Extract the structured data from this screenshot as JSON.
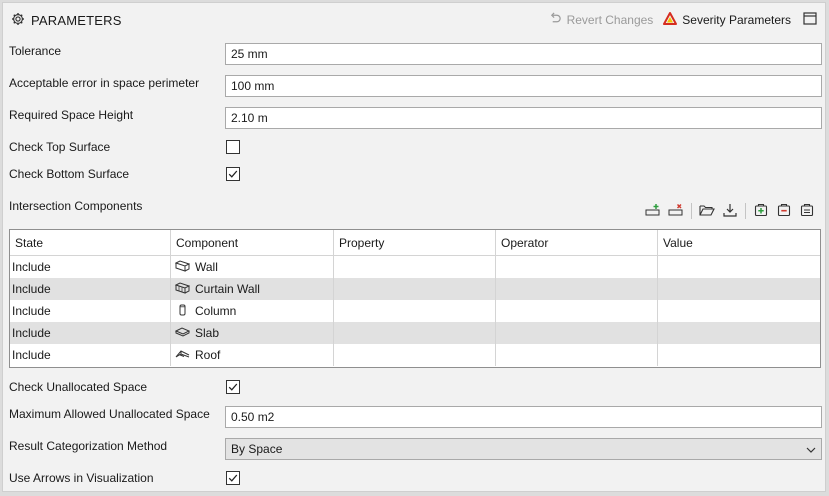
{
  "header": {
    "title": "PARAMETERS",
    "revert_label": "Revert Changes",
    "severity_label": "Severity Parameters"
  },
  "fields": {
    "tolerance": {
      "label": "Tolerance",
      "value": "25 mm"
    },
    "perimeter_error": {
      "label": "Acceptable error in space perimeter",
      "value": "100 mm"
    },
    "space_height": {
      "label": "Required Space Height",
      "value": "2.10 m"
    },
    "check_top": {
      "label": "Check Top Surface",
      "checked": false
    },
    "check_bottom": {
      "label": "Check Bottom Surface",
      "checked": true
    }
  },
  "intersection": {
    "label": "Intersection Components",
    "columns": [
      "State",
      "Component",
      "Property",
      "Operator",
      "Value"
    ],
    "rows": [
      {
        "state": "Include",
        "component": "Wall",
        "icon": "wall-icon",
        "property": "",
        "operator": "",
        "value": ""
      },
      {
        "state": "Include",
        "component": "Curtain Wall",
        "icon": "curtain-wall-icon",
        "property": "",
        "operator": "",
        "value": ""
      },
      {
        "state": "Include",
        "component": "Column",
        "icon": "column-icon",
        "property": "",
        "operator": "",
        "value": ""
      },
      {
        "state": "Include",
        "component": "Slab",
        "icon": "slab-icon",
        "property": "",
        "operator": "",
        "value": ""
      },
      {
        "state": "Include",
        "component": "Roof",
        "icon": "roof-icon",
        "property": "",
        "operator": "",
        "value": ""
      }
    ],
    "toolbar_icons": [
      "add-row-icon",
      "remove-row-icon",
      "open-folder-icon",
      "download-icon",
      "add-component-icon",
      "remove-component-icon",
      "edit-component-icon"
    ]
  },
  "footer_fields": {
    "check_unallocated": {
      "label": "Check Unallocated Space",
      "checked": true
    },
    "max_unallocated": {
      "label": "Maximum Allowed Unallocated Space",
      "value": "0.50 m2"
    },
    "categorization": {
      "label": "Result Categorization Method",
      "value": "By Space"
    },
    "use_arrows": {
      "label": "Use Arrows in Visualization",
      "checked": true
    }
  },
  "colors": {
    "warning_red": "#d62d20",
    "warning_yellow": "#f2c500",
    "add_green": "#2e9e3e",
    "remove_red": "#d03a2f"
  }
}
